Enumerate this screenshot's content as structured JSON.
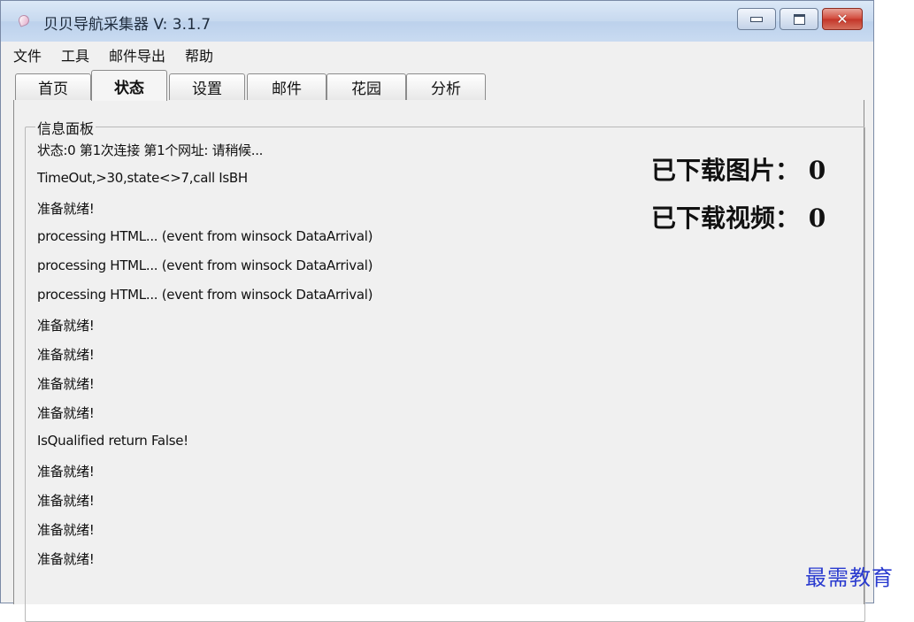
{
  "window": {
    "title": "贝贝导航采集器 V: 3.1.7",
    "controls": {
      "close_glyph": "✕"
    }
  },
  "menubar": {
    "items": [
      "文件",
      "工具",
      "邮件导出",
      "帮助"
    ]
  },
  "tabs": [
    {
      "label": "首页",
      "active": false
    },
    {
      "label": "状态",
      "active": true
    },
    {
      "label": "设置",
      "active": false
    },
    {
      "label": "邮件",
      "active": false
    },
    {
      "label": "花园",
      "active": false
    },
    {
      "label": "分析",
      "active": false
    }
  ],
  "panel": {
    "group_title": "信息面板",
    "log_lines": [
      "状态:0 第1次连接 第1个网址: 请稍候...",
      "TimeOut,>30,state<>7,call IsBH",
      "准备就绪!",
      "processing HTML... (event from winsock DataArrival)",
      "processing HTML... (event from winsock DataArrival)",
      "processing HTML... (event from winsock DataArrival)",
      "准备就绪!",
      "准备就绪!",
      "准备就绪!",
      "准备就绪!",
      "IsQualified return False!",
      "准备就绪!",
      "准备就绪!",
      "准备就绪!",
      "准备就绪!"
    ],
    "counters": {
      "images": "已下载图片： 0",
      "videos": "已下载视频： 0"
    }
  },
  "watermark": "最需教育",
  "colors": {
    "titlebar": "#c7d9ef",
    "panel_bg": "#f0f0f0",
    "close_button": "#c33427",
    "watermark": "#2a3bcf"
  }
}
